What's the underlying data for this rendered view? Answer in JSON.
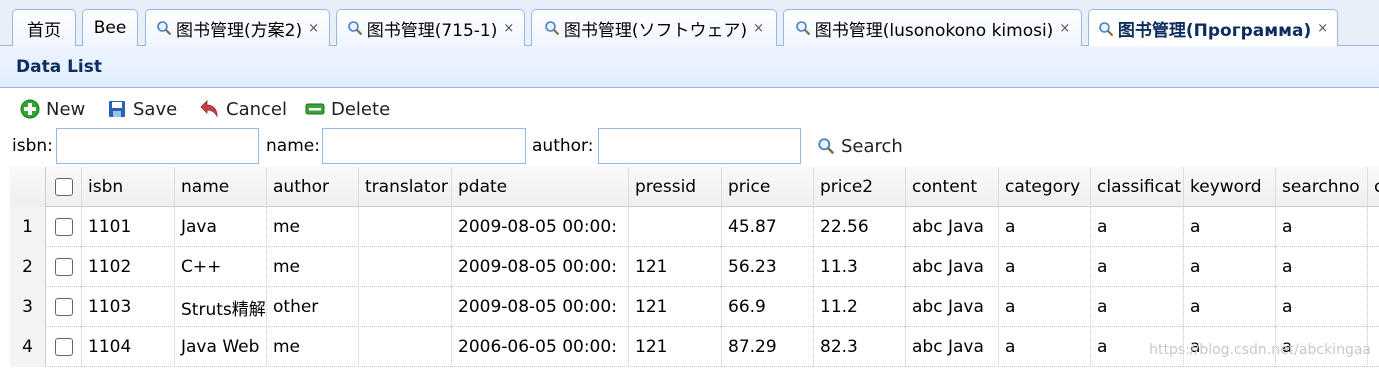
{
  "tabs": [
    {
      "label": "首页",
      "icon": "",
      "closable": false
    },
    {
      "label": "Bee",
      "icon": "",
      "closable": false
    },
    {
      "label": "图书管理(方案2)",
      "icon": "search-icon",
      "closable": true
    },
    {
      "label": "图书管理(715-1)",
      "icon": "search-icon",
      "closable": true
    },
    {
      "label": "图书管理(ソフトウェア)",
      "icon": "search-icon",
      "closable": true
    },
    {
      "label": "图书管理(lusonokono kimosi)",
      "icon": "search-icon",
      "closable": true
    },
    {
      "label": "图书管理(Программа)",
      "icon": "search-icon",
      "closable": true,
      "active": true
    }
  ],
  "close_glyph": "×",
  "panel": {
    "title": "Data List"
  },
  "toolbar": {
    "new_label": "New",
    "save_label": "Save",
    "cancel_label": "Cancel",
    "delete_label": "Delete"
  },
  "search": {
    "isbn_label": "isbn:",
    "isbn_value": "",
    "name_label": "name:",
    "name_value": "",
    "author_label": "author:",
    "author_value": "",
    "button_label": "Search"
  },
  "columns": [
    "isbn",
    "name",
    "author",
    "translator",
    "pdate",
    "pressid",
    "price",
    "price2",
    "content",
    "category",
    "classificat",
    "keyword",
    "searchno",
    "c"
  ],
  "rows": [
    {
      "num": "1",
      "cells": [
        "1101",
        "Java",
        "me",
        "",
        "2009-08-05 00:00:",
        "",
        "45.87",
        "22.56",
        "abc Java",
        "a",
        "a",
        "a",
        "a",
        ""
      ]
    },
    {
      "num": "2",
      "cells": [
        "1102",
        "C++",
        "me",
        "",
        "2009-08-05 00:00:",
        "121",
        "56.23",
        "11.3",
        "abc Java",
        "a",
        "a",
        "a",
        "a",
        ""
      ]
    },
    {
      "num": "3",
      "cells": [
        "1103",
        "Struts精解",
        "other",
        "",
        "2009-08-05 00:00:",
        "121",
        "66.9",
        "11.2",
        "abc Java",
        "a",
        "a",
        "a",
        "a",
        ""
      ]
    },
    {
      "num": "4",
      "cells": [
        "1104",
        "Java Web",
        "me",
        "",
        "2006-06-05 00:00:",
        "121",
        "87.29",
        "82.3",
        "abc Java",
        "a",
        "a",
        "a",
        "a",
        ""
      ]
    }
  ],
  "watermark": "https://blog.csdn.net/abckingaa",
  "colors": {
    "accent": "#95b8e7",
    "header_text": "#0e2d5f",
    "new_icon": "#2fa52f",
    "save_icon": "#2a62b7",
    "cancel_icon": "#c94040",
    "delete_icon": "#3aa33a"
  }
}
